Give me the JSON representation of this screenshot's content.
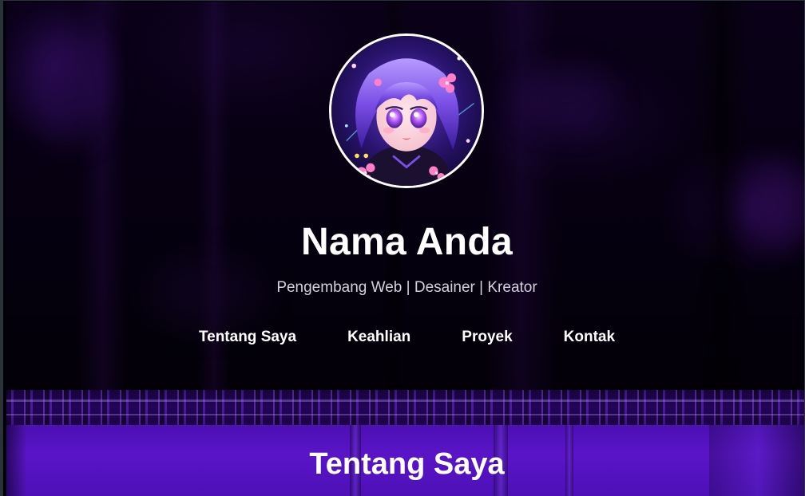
{
  "hero": {
    "name": "Nama Anda",
    "subtitle": "Pengembang Web | Desainer | Kreator",
    "avatar_icon": "anime-girl-avatar"
  },
  "nav": {
    "items": [
      {
        "label": "Tentang Saya"
      },
      {
        "label": "Keahlian"
      },
      {
        "label": "Proyek"
      },
      {
        "label": "Kontak"
      }
    ]
  },
  "about": {
    "title": "Tentang Saya"
  },
  "colors": {
    "hero_background": "#05000f",
    "section_purple": "#5a14c8",
    "text": "#ffffff",
    "subtitle_text": "#d4d0dc",
    "avatar_border": "#ffffff"
  }
}
